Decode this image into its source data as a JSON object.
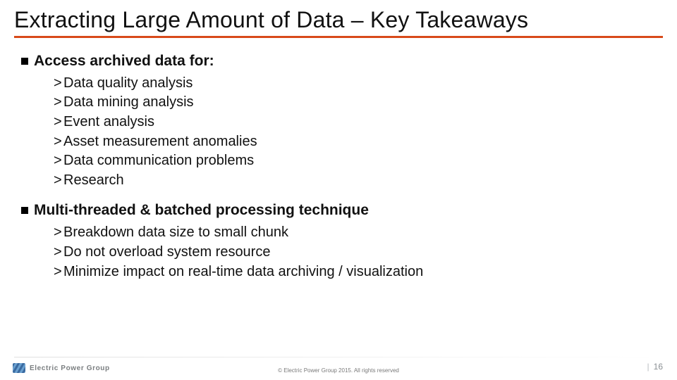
{
  "title": "Extracting Large Amount of Data – Key Takeaways",
  "sections": [
    {
      "heading": "Access archived data for:",
      "items": [
        "Data quality analysis",
        "Data mining analysis",
        "Event analysis",
        "Asset measurement anomalies",
        "Data communication problems",
        "Research"
      ]
    },
    {
      "heading": "Multi-threaded & batched processing technique",
      "items": [
        "Breakdown data size to small chunk",
        "Do not overload system resource",
        "Minimize impact on real-time data archiving / visualization"
      ]
    }
  ],
  "footer": {
    "logo_text": "Electric Power Group",
    "copyright": "© Electric Power Group 2015. All rights reserved",
    "page_number": "16"
  }
}
